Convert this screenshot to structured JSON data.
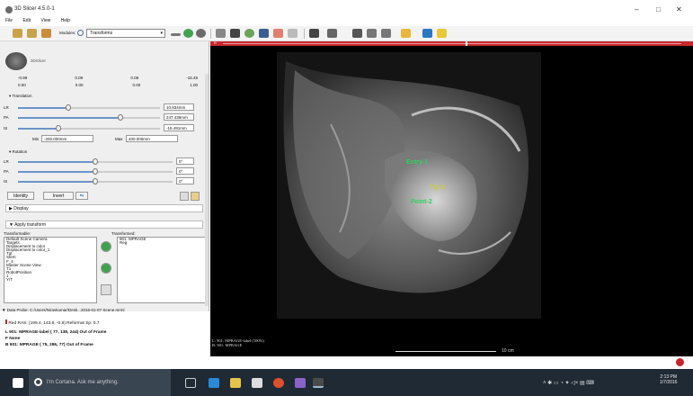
{
  "window": {
    "title": "3D Slicer 4.5.0-1",
    "minimize": "–",
    "maximize": "□",
    "close": "✕"
  },
  "menu": [
    "File",
    "Edit",
    "View",
    "Help"
  ],
  "toolbar": {
    "modules_label": "Modules:",
    "module_value": "Transforms",
    "icons": [
      "load-icon",
      "save-icon",
      "dcm-icon",
      "module-search-icon",
      "back-icon",
      "forward-icon",
      "layout-icon",
      "3d-icon",
      "mesh-icon",
      "fiducial-icon",
      "ruler-icon",
      "crosshair-icon",
      "pencil-icon",
      "slice-icon",
      "screenshot-icon",
      "scene-icon",
      "camera-icon",
      "addfid-icon",
      "python-icon",
      "extension-icon"
    ]
  },
  "logo": "3DSlicer",
  "matrix": [
    [
      "-0.99",
      "0.09",
      "0.08",
      "-16.49"
    ],
    [
      "0.00",
      "0.00",
      "0.00",
      "1.00"
    ]
  ],
  "translation": {
    "title": "Translation",
    "rows": [
      {
        "label": "LR",
        "value": "10.834mm",
        "pos": 0.35
      },
      {
        "label": "PA",
        "value": "247.436mm",
        "pos": 0.72
      },
      {
        "label": "IS",
        "value": "-16.491mm",
        "pos": 0.28
      }
    ],
    "min_label": "Min",
    "min_value": "-200.000mm",
    "max_label": "Max",
    "max_value": "400.000mm"
  },
  "rotation": {
    "title": "Rotation",
    "rows": [
      {
        "label": "LR",
        "value": "0°",
        "pos": 0.5
      },
      {
        "label": "PA",
        "value": "0°",
        "pos": 0.5
      },
      {
        "label": "IS",
        "value": "0°",
        "pos": 0.5
      }
    ]
  },
  "buttons": {
    "identity": "Identity",
    "invert": "Invert"
  },
  "display": "Display",
  "apply": "Apply transform",
  "transformable_label": "Transformable:",
  "transformed_label": "Transformed:",
  "transformable": [
    "Default Scene Camera",
    "Targets",
    "Displacement to color",
    "Displacement to color_1",
    "Tgt",
    "Stem",
    "F_4",
    "Master Scene View",
    "T1",
    "RobotPosition",
    "1",
    "Y/T"
  ],
  "transformed": [
    "901: MPRAGE",
    "Reg"
  ],
  "probe": {
    "title": "Data Probe: C:/Users/Nirav​kumar/Desk...2016-01-07-Scene.mrml",
    "line1": "Red    RAS: (199.4, 143.6, -0.8)  Reformat Sp: 0.7",
    "line2": "L 901: MPRAGE-label ( 77, 138, 244) Out of Frame",
    "line3": "F None",
    "line4": "B 901: MPRAGE        ( 75, 286, 77) Out of Frame"
  },
  "viewer": {
    "label": "R",
    "corner1": "L: 901: MPRAGE-label (100%)",
    "corner2": "B: 901: MPRAGE",
    "scale": "10 cm"
  },
  "landmarks": [
    {
      "label": "Entry-1"
    },
    {
      "label": "Tgt-3"
    },
    {
      "label": "Point-2"
    }
  ],
  "taskbar": {
    "search": "I'm Cortana. Ask me anything.",
    "time": "2:13 PM",
    "date": "1/7/2016"
  }
}
